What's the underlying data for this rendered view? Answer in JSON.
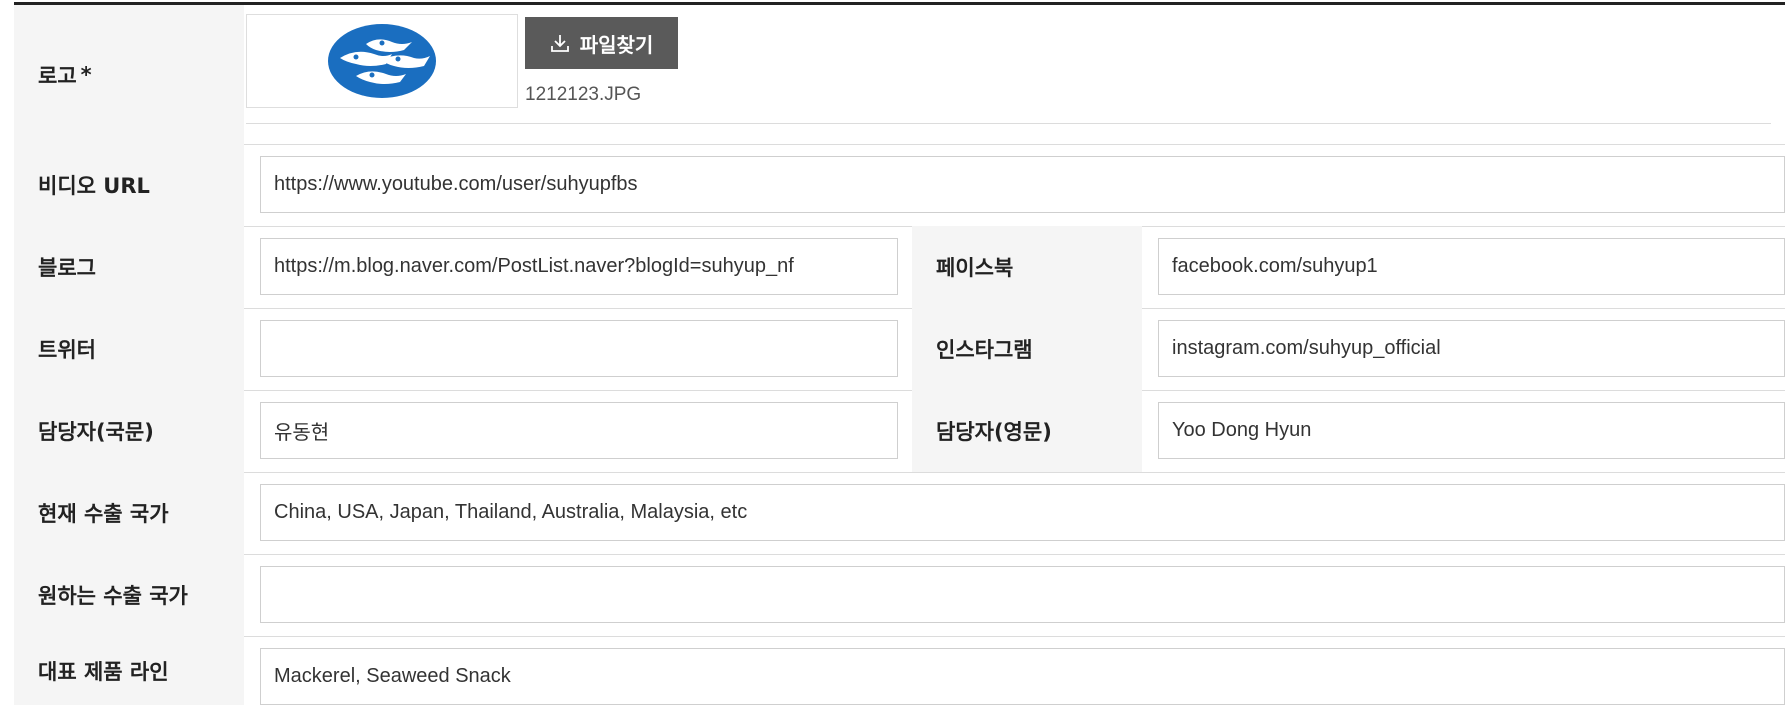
{
  "logo_row": {
    "label": "로고",
    "required_mark": "*",
    "file_button_label": "파일찾기",
    "file_name": "1212123.JPG"
  },
  "rows": {
    "video_url": {
      "label": "비디오 URL",
      "value": "https://www.youtube.com/user/suhyupfbs"
    },
    "blog": {
      "label": "블로그",
      "value": "https://m.blog.naver.com/PostList.naver?blogId=suhyup_nf"
    },
    "facebook": {
      "label": "페이스북",
      "value": "facebook.com/suhyup1"
    },
    "twitter": {
      "label": "트위터",
      "value": ""
    },
    "instagram": {
      "label": "인스타그램",
      "value": "instagram.com/suhyup_official"
    },
    "contact_ko": {
      "label": "담당자(국문)",
      "value": "유동현"
    },
    "contact_en": {
      "label": "담당자(영문)",
      "value": "Yoo Dong Hyun"
    },
    "current_export": {
      "label": "현재 수출 국가",
      "value": "China, USA, Japan, Thailand, Australia, Malaysia, etc"
    },
    "desired_export": {
      "label": "원하는 수출 국가",
      "value": ""
    },
    "main_products": {
      "label": "대표 제품 라인",
      "value": "Mackerel, Seaweed Snack"
    }
  },
  "colors": {
    "logo_blue": "#1a6ec0",
    "button_bg": "#5a5a5a",
    "header_bg": "#f5f5f5"
  },
  "icons": {
    "download": "download-icon"
  }
}
